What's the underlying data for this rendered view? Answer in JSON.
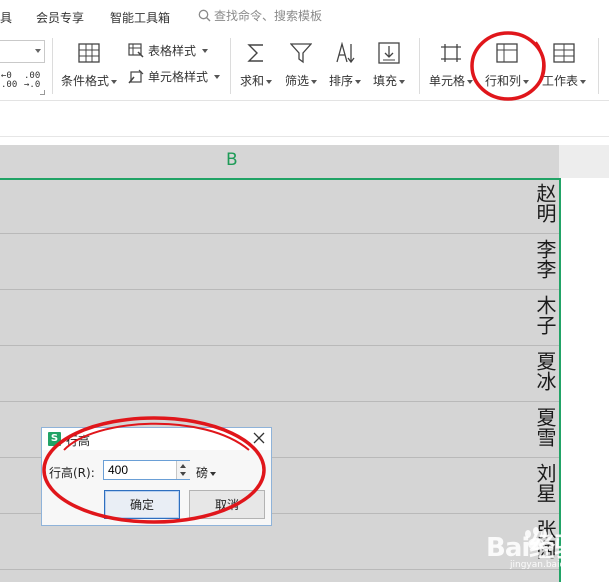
{
  "menu": {
    "partial_left": "具",
    "items": [
      "会员专享",
      "智能工具箱"
    ],
    "search_placeholder": "查找命令、搜索模板"
  },
  "ribbon": {
    "decimal_increase": "←0\n.00",
    "decimal_decrease": ".00\n→.0",
    "conditional_format": "条件格式",
    "table_style": "表格样式",
    "cell_style": "单元格样式",
    "sum": "求和",
    "filter": "筛选",
    "sort": "排序",
    "fill": "填充",
    "cell": "单元格",
    "row_col": "行和列",
    "worksheet": "工作表"
  },
  "sheet": {
    "column_b": "B",
    "cells": [
      "赵明",
      "李李",
      "木子",
      "夏冰",
      "夏雪",
      "刘星",
      "张阔"
    ]
  },
  "dialog": {
    "title": "行高",
    "row_height_label": "行高(R):",
    "row_height_value": "400",
    "unit": "磅",
    "ok": "确定",
    "cancel": "取消"
  },
  "watermark": {
    "text": "Bai经验",
    "url": "jingyan.baidu.com"
  },
  "colors": {
    "accent_green": "#21a366",
    "annotation_red": "#e0161b",
    "grid_fill": "#d5d5d5"
  }
}
